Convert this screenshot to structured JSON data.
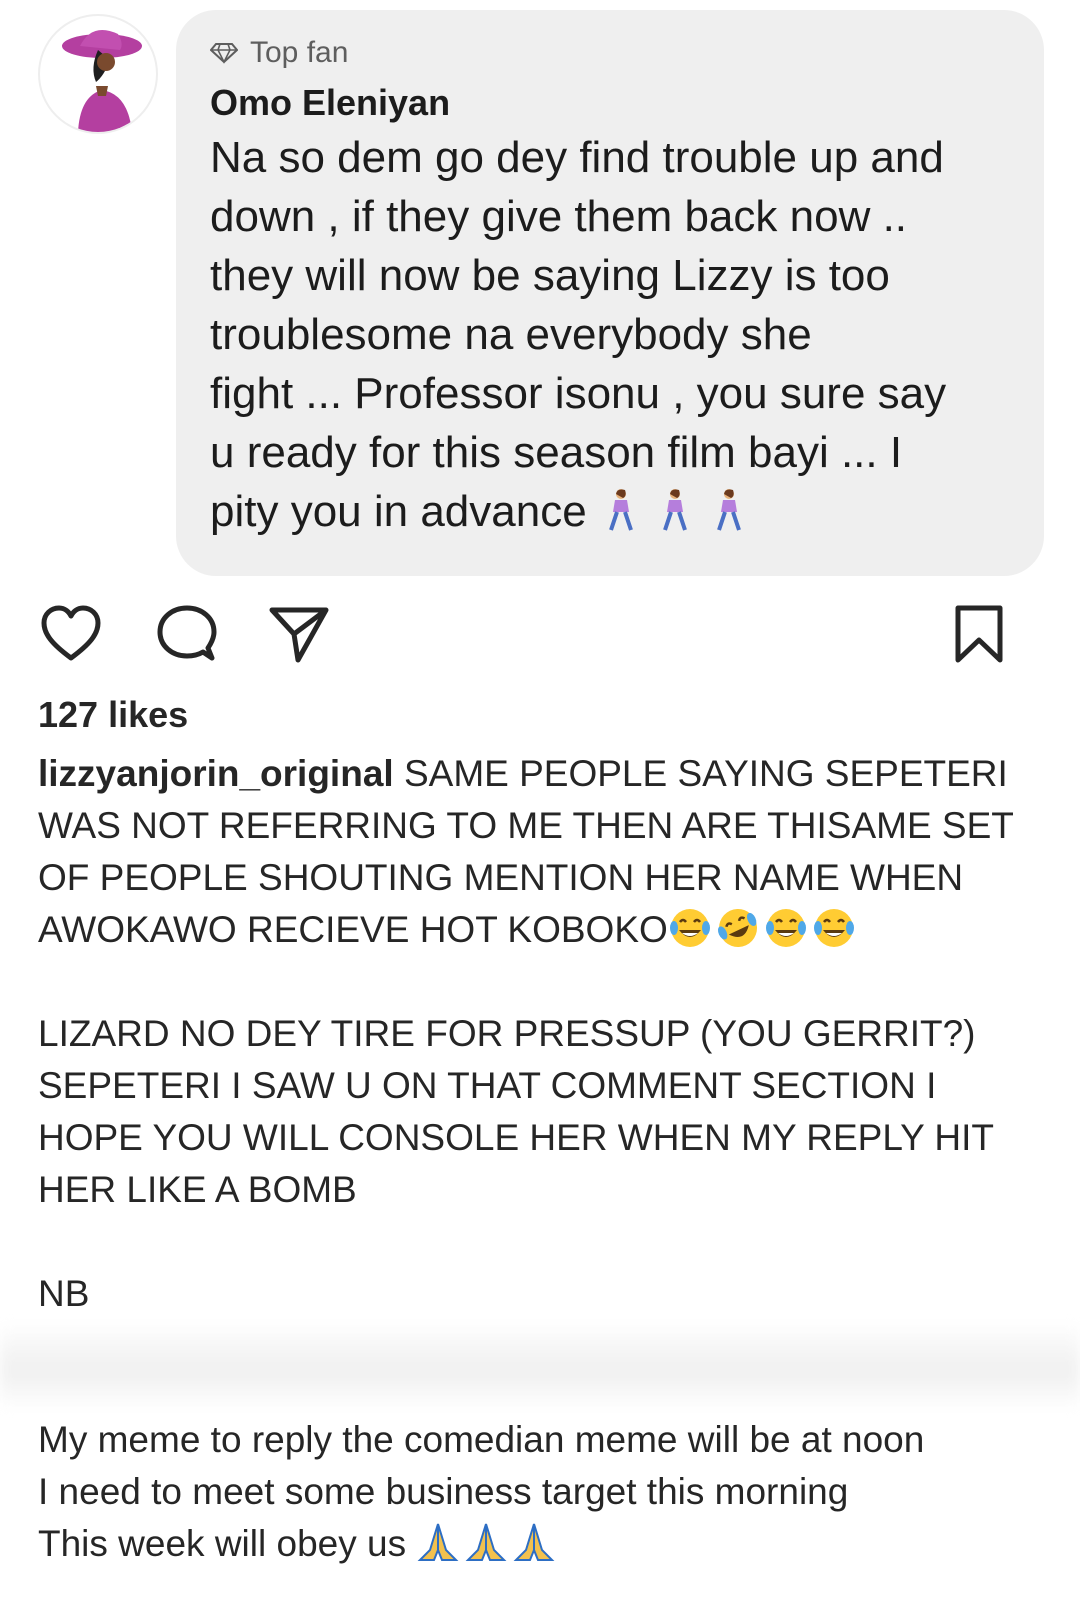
{
  "comment": {
    "avatar_icon": "woman-with-pink-hat-avatar",
    "badge_icon": "diamond-icon",
    "badge_label": "Top fan",
    "author": "Omo Eleniyan",
    "lines": [
      "Na so dem go dey find trouble up and",
      "down , if they give them back now ..",
      "they will now be saying Lizzy is too",
      "troublesome na everybody she",
      "fight ... Professor isonu , you sure say",
      "u ready for this season film bayi ... I",
      "pity you in advance"
    ],
    "trailing_emoji": [
      "woman-walking-icon",
      "woman-walking-icon",
      "woman-walking-icon"
    ]
  },
  "actions": {
    "like_icon": "heart-icon",
    "comment_icon": "comment-bubble-icon",
    "share_icon": "paper-plane-icon",
    "save_icon": "bookmark-icon"
  },
  "likes": "127 likes",
  "caption": {
    "username": "lizzyanjorin_original",
    "first_line_text": " SAME PEOPLE SAYING SEPETERI",
    "lines_block1": [
      "WAS NOT REFERRING TO ME THEN ARE THISAME SET",
      "OF PEOPLE SHOUTING MENTION HER NAME WHEN"
    ],
    "line_with_emoji": "AWOKAWO RECIEVE  HOT KOBOKO",
    "laugh_emoji": [
      "face-with-tears-of-joy-icon",
      "rolling-on-floor-laughing-icon",
      "face-with-tears-of-joy-icon",
      "face-with-tears-of-joy-icon"
    ],
    "lines_block2": [
      "LIZARD NO DEY TIRE FOR PRESSUP (YOU GERRIT?)",
      "SEPETERI I SAW U ON THAT COMMENT SECTION I",
      "HOPE YOU WILL CONSOLE HER WHEN MY REPLY HIT",
      "HER LIKE A BOMB"
    ],
    "nb": "NB",
    "tail_lines": [
      "My meme to reply the comedian meme  will be at noon",
      "I need to meet some business target this morning"
    ],
    "last_line": "This week will obey us",
    "pray_emoji": [
      "folded-hands-icon",
      "folded-hands-icon",
      "folded-hands-icon"
    ]
  },
  "colors": {
    "bubble_bg": "#efefef",
    "text": "#262626",
    "muted": "#5e5e5e",
    "avatar_accent": "#b43fa0"
  }
}
